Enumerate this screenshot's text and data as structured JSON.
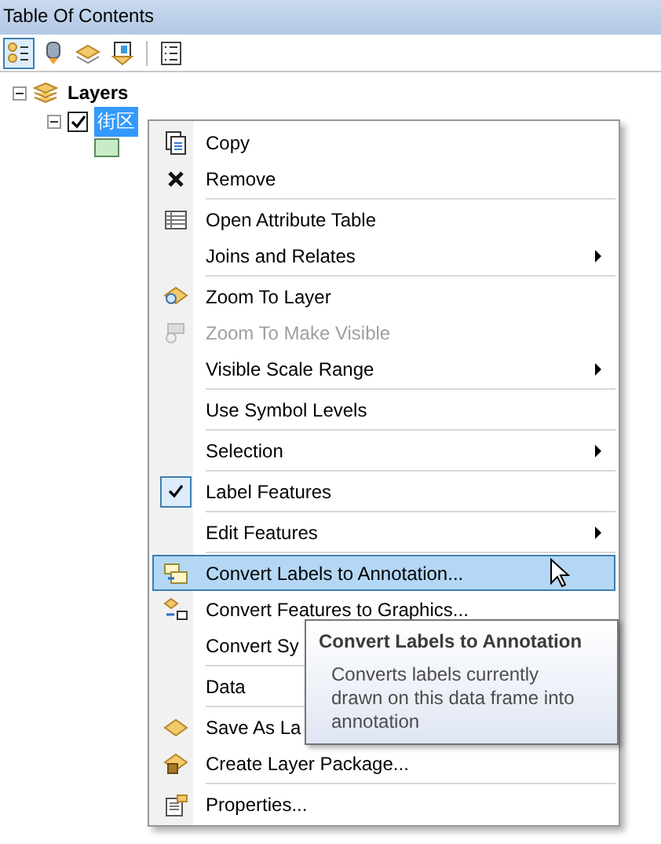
{
  "window": {
    "title": "Table Of Contents"
  },
  "toolbar": [
    {
      "selected": true
    },
    {
      "selected": false
    },
    {
      "selected": false
    },
    {
      "selected": false
    },
    {
      "selected": false
    }
  ],
  "tree": {
    "label": "Layers",
    "expanded": true,
    "children": [
      {
        "label": "街区",
        "expanded": true,
        "checked": true,
        "selected": true
      }
    ]
  },
  "menu": [
    {
      "kind": "item",
      "label": "Copy"
    },
    {
      "kind": "item",
      "label": "Remove"
    },
    {
      "kind": "separator"
    },
    {
      "kind": "item",
      "label": "Open Attribute Table"
    },
    {
      "kind": "item",
      "label": "Joins and Relates",
      "submenu": true
    },
    {
      "kind": "separator"
    },
    {
      "kind": "item",
      "label": "Zoom To Layer"
    },
    {
      "kind": "item",
      "label": "Zoom To Make Visible",
      "disabled": true
    },
    {
      "kind": "item",
      "label": "Visible Scale Range",
      "submenu": true
    },
    {
      "kind": "separator"
    },
    {
      "kind": "item",
      "label": "Use Symbol Levels"
    },
    {
      "kind": "separator"
    },
    {
      "kind": "item",
      "label": "Selection",
      "submenu": true
    },
    {
      "kind": "separator"
    },
    {
      "kind": "item",
      "label": "Label Features",
      "checked": true
    },
    {
      "kind": "separator"
    },
    {
      "kind": "item",
      "label": "Edit Features",
      "submenu": true
    },
    {
      "kind": "separator"
    },
    {
      "kind": "item",
      "label": "Convert Labels to Annotation...",
      "selected": true
    },
    {
      "kind": "item",
      "label": "Convert Features to Graphics..."
    },
    {
      "kind": "item",
      "label": "Convert Sy"
    },
    {
      "kind": "separator"
    },
    {
      "kind": "item",
      "label": "Data"
    },
    {
      "kind": "separator"
    },
    {
      "kind": "item",
      "label": "Save As La"
    },
    {
      "kind": "item",
      "label": "Create Layer Package..."
    },
    {
      "kind": "separator"
    },
    {
      "kind": "item",
      "label": "Properties..."
    }
  ],
  "tooltip": {
    "title": "Convert Labels to Annotation",
    "text": "Converts labels currently drawn on this data frame into annotation"
  }
}
